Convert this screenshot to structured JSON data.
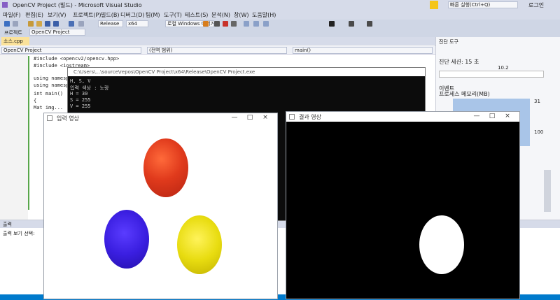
{
  "vs": {
    "title": "OpenCV Project (빌드) - Microsoft Visual Studio",
    "quick_launch": "빠른 실행(Ctrl+Q)",
    "user": "로그인",
    "menu": [
      "파일(F)",
      "편집(E)",
      "보기(V)",
      "프로젝트(P)",
      "빌드(B)",
      "디버그(D)",
      "팀(M)",
      "도구(T)",
      "테스트(S)",
      "분석(N)",
      "창(W)",
      "도움말(H)"
    ],
    "config": "Release",
    "platform": "x64",
    "debugger": "로컬 Windows 디버거",
    "solution_label": "프로젝트",
    "solution_combo": "OpenCV Project",
    "tab_active": "소스.cpp",
    "nav_project": "OpenCV Project",
    "nav_scope": "(전역 범위)",
    "nav_member": "main()",
    "code_lines": [
      "#include <opencv2/opencv.hpp>",
      "#include <iostream>",
      "",
      "using namespace cv;",
      "using namespace std;",
      "",
      "int main()",
      "{",
      "    Mat img..."
    ]
  },
  "right_panel": {
    "title": "진단 도구",
    "session": "진단 세션: 15 초",
    "events": "이벤트",
    "process_memory": "프로세스 메모리(MB)",
    "values": [
      "10.2",
      "31",
      "100"
    ]
  },
  "output_panel": {
    "title": "출력",
    "source_label": "출력 보기 선택:"
  },
  "console": {
    "title": "C:\\Users\\...\\source\\repos\\OpenCV Project\\x64\\Release\\OpenCV Project.exe",
    "lines": [
      "H, S, V",
      "입력 색상 : 노랑",
      "H = 30",
      "S = 255",
      "V = 255"
    ]
  },
  "window_input": {
    "title": "입력 영상",
    "balls": [
      {
        "name": "red-ball",
        "color": "#e03a1c"
      },
      {
        "name": "blue-ball",
        "color": "#3a1ee0"
      },
      {
        "name": "yellow-ball",
        "color": "#e8dc10"
      }
    ]
  },
  "window_result": {
    "title": "결과 영상",
    "mask_color": "#ffffff",
    "background": "#000000"
  },
  "colors": {
    "accent": "#007acc",
    "title_bg": "#d6dbe9"
  }
}
